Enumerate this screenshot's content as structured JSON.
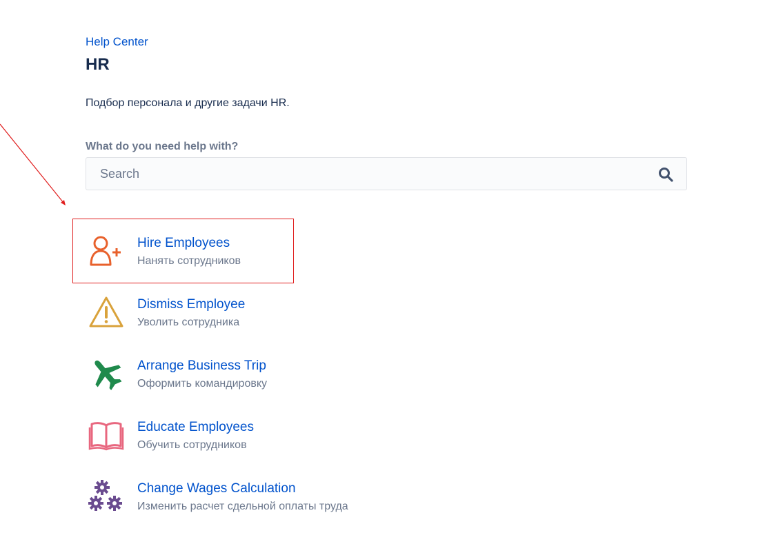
{
  "breadcrumb": {
    "label": "Help Center"
  },
  "header": {
    "title": "HR",
    "description": "Подбор персонала и другие задачи HR."
  },
  "search": {
    "label": "What do you need help with?",
    "placeholder": "Search",
    "value": "",
    "icon": "search-icon"
  },
  "requests": [
    {
      "title": "Hire Employees",
      "description": "Нанять сотрудников",
      "icon": "add-user-icon",
      "color": "#e8612c"
    },
    {
      "title": "Dismiss Employee",
      "description": "Уволить сотрудника",
      "icon": "warning-icon",
      "color": "#d9a23b"
    },
    {
      "title": "Arrange Business Trip",
      "description": "Оформить командировку",
      "icon": "airplane-icon",
      "color": "#1f8a4c"
    },
    {
      "title": "Educate Employees",
      "description": "Обучить сотрудников",
      "icon": "book-icon",
      "color": "#e8677f"
    },
    {
      "title": "Change Wages Calculation",
      "description": "Изменить расчет сдельной оплаты труда",
      "icon": "gears-icon",
      "color": "#6a4b8f"
    }
  ],
  "annotation": {
    "highlight_color": "#e01e1e"
  }
}
